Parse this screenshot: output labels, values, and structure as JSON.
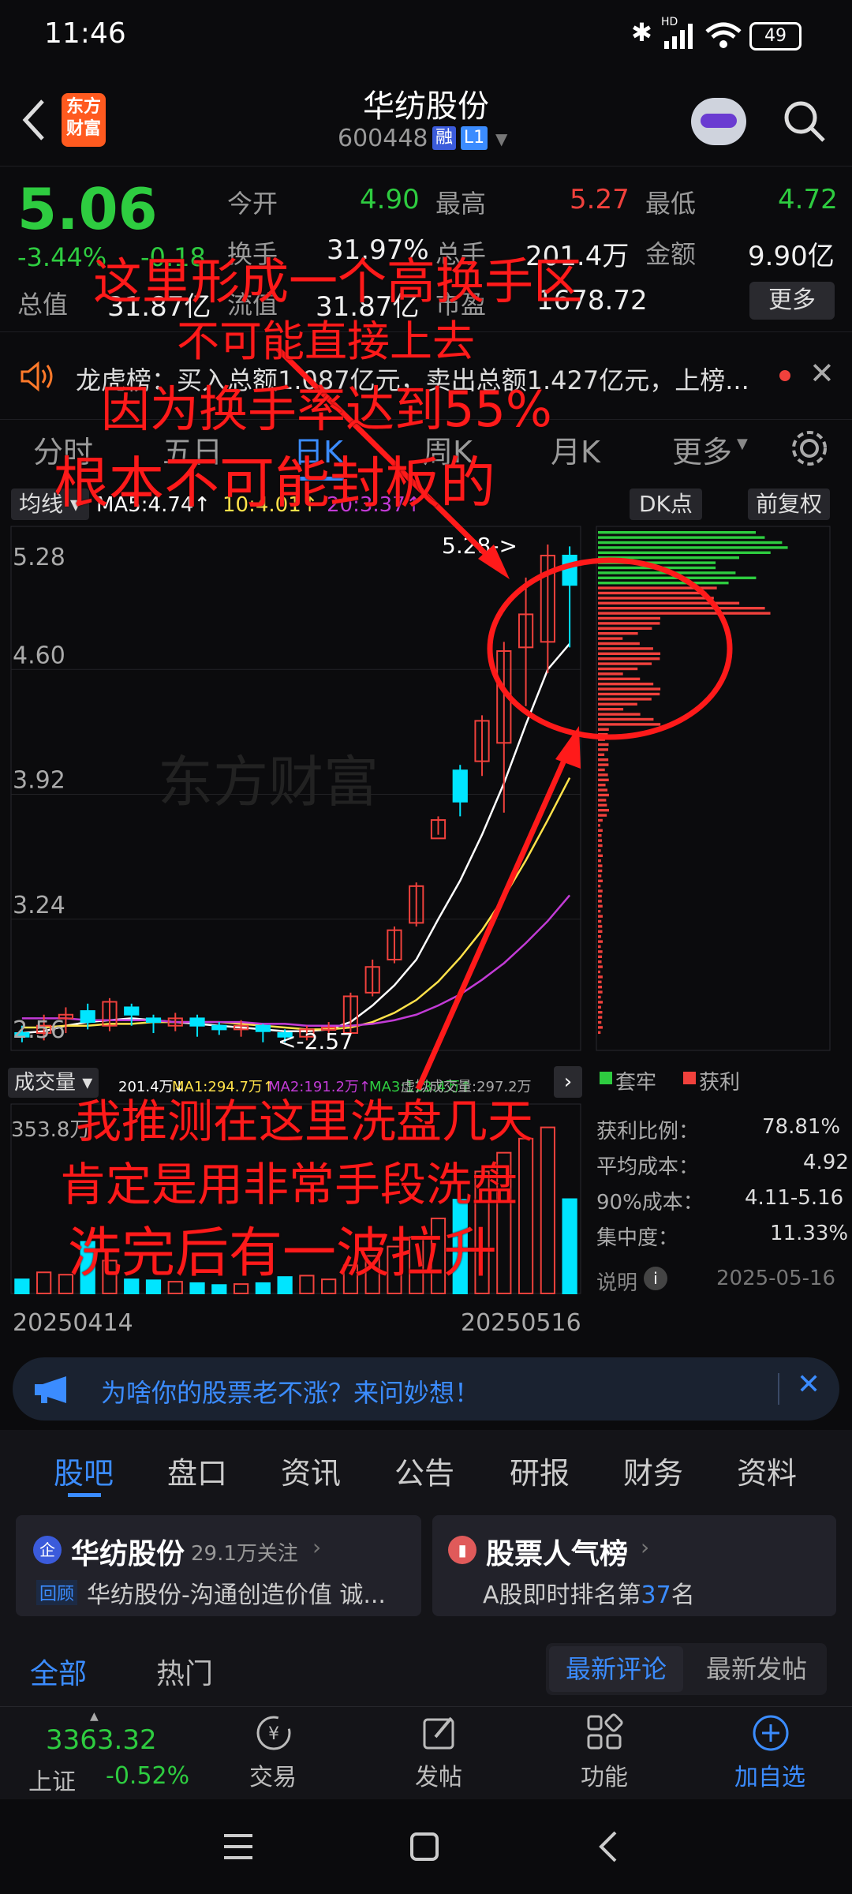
{
  "status": {
    "time": "11:46",
    "battery": "49",
    "network": "HD"
  },
  "header": {
    "app_logo_text": "东方\n财富",
    "title": "华纺股份",
    "code": "600448",
    "badge_rong": "融",
    "badge_level": "L1"
  },
  "quote": {
    "price": "5.06",
    "change_pct": "-3.44%",
    "change": "-0.18",
    "open_label": "今开",
    "open": "4.90",
    "high_label": "最高",
    "high": "5.27",
    "low_label": "最低",
    "low": "4.72",
    "turnover_label": "换手",
    "turnover": "31.97%",
    "volume_label": "总手",
    "volume": "201.4万",
    "amount_label": "金额",
    "amount": "9.90亿",
    "total_cap_label": "总值",
    "total_cap": "31.87亿",
    "float_cap_label": "流值",
    "float_cap": "31.87亿",
    "pe_label": "市盈",
    "pe": "1678.72",
    "more_button": "更多"
  },
  "dragon_tiger": {
    "text": "龙虎榜：买入总额1.087亿元，卖出总额1.427亿元，上榜..."
  },
  "period_tabs": [
    "分时",
    "五日",
    "日K",
    "周K",
    "月K",
    "更多"
  ],
  "chart_toolbar": {
    "ma_dropdown": "均线",
    "ma5": "MA5:4.74↑",
    "ma10": "10:4.01↑",
    "ma20": "20:3.37↑",
    "dk_button": "DK点",
    "fq_button": "前复权"
  },
  "chart_axis": {
    "y_labels": [
      "5.28",
      "4.60",
      "3.92",
      "3.24",
      "2.56"
    ],
    "max_label": "5.28->",
    "min_label": "<-2.57",
    "watermark": "东方财富"
  },
  "volume_toolbar": {
    "dropdown": "成交量",
    "vol": "201.4万↓",
    "ma1": "MA1:294.7万↑",
    "ma2": "MA2:191.2万↑",
    "ma3": "MA3:113.4万↑",
    "virtual": "虚拟成交量:297.2万",
    "max_label": "353.8万"
  },
  "dates": {
    "start": "20250414",
    "end": "20250516"
  },
  "chips": {
    "legend_trap": "套牢",
    "legend_profit": "获利",
    "rows": [
      {
        "label": "获利比例：",
        "value": "78.81%"
      },
      {
        "label": "平均成本：",
        "value": "4.92"
      },
      {
        "label": "90%成本：",
        "value": "4.11-5.16"
      },
      {
        "label": "集中度：",
        "value": "11.33%"
      }
    ],
    "note_label": "说明",
    "date": "2025-05-16"
  },
  "banner": {
    "text": "为啥你的股票老不涨？来问妙想！"
  },
  "bottom_tabs": [
    "股吧",
    "盘口",
    "资讯",
    "公告",
    "研报",
    "财务",
    "资料"
  ],
  "cards": {
    "left_title": "华纺股份",
    "left_follow": "29.1万关注",
    "left_tag": "回顾",
    "left_sub": "华纺股份-沟通创造价值  诚...",
    "right_title": "股票人气榜",
    "right_sub_prefix": "A股即时排名第",
    "right_rank": "37",
    "right_sub_suffix": "名"
  },
  "filters": {
    "all": "全部",
    "hot": "热门",
    "latest_comment": "最新评论",
    "latest_post": "最新发帖"
  },
  "bottom_nav": {
    "index_value": "3363.32",
    "index_name": "上证",
    "index_change": "-0.52%",
    "trade": "交易",
    "post": "发帖",
    "function": "功能",
    "add": "加自选"
  },
  "annotations": {
    "line1": "这里形成一个高换手区",
    "line2": "不可能直接上去",
    "line3": "因为换手率达到55%",
    "line4": "根本不可能封板的",
    "line5": "我推测在这里洗盘几天",
    "line6": "肯定是用非常手段洗盘",
    "line7": "洗完后有一波拉升"
  },
  "colors": {
    "up": "#f0413c",
    "down": "#2ecc40",
    "accent": "#3b8cff",
    "cyan": "#00e5ff",
    "annotation": "#ff1a1a"
  },
  "chart_data": {
    "type": "candlestick",
    "dates_range": [
      "20250414",
      "20250516"
    ],
    "ylim": [
      2.56,
      5.28
    ],
    "candles": [
      {
        "o": 2.62,
        "c": 2.6,
        "h": 2.66,
        "l": 2.57
      },
      {
        "o": 2.62,
        "c": 2.66,
        "h": 2.72,
        "l": 2.58
      },
      {
        "o": 2.7,
        "c": 2.72,
        "h": 2.76,
        "l": 2.62
      },
      {
        "o": 2.74,
        "c": 2.68,
        "h": 2.78,
        "l": 2.64
      },
      {
        "o": 2.66,
        "c": 2.79,
        "h": 2.81,
        "l": 2.63
      },
      {
        "o": 2.76,
        "c": 2.72,
        "h": 2.78,
        "l": 2.66
      },
      {
        "o": 2.7,
        "c": 2.68,
        "h": 2.72,
        "l": 2.62
      },
      {
        "o": 2.66,
        "c": 2.7,
        "h": 2.73,
        "l": 2.63
      },
      {
        "o": 2.7,
        "c": 2.66,
        "h": 2.72,
        "l": 2.6
      },
      {
        "o": 2.66,
        "c": 2.64,
        "h": 2.68,
        "l": 2.61
      },
      {
        "o": 2.64,
        "c": 2.66,
        "h": 2.69,
        "l": 2.6
      },
      {
        "o": 2.66,
        "c": 2.63,
        "h": 2.67,
        "l": 2.57
      },
      {
        "o": 2.62,
        "c": 2.6,
        "h": 2.64,
        "l": 2.57
      },
      {
        "o": 2.6,
        "c": 2.64,
        "h": 2.66,
        "l": 2.58
      },
      {
        "o": 2.64,
        "c": 2.65,
        "h": 2.68,
        "l": 2.62
      },
      {
        "o": 2.62,
        "c": 2.82,
        "h": 2.84,
        "l": 2.62
      },
      {
        "o": 2.84,
        "c": 2.98,
        "h": 3.02,
        "l": 2.82
      },
      {
        "o": 3.02,
        "c": 3.18,
        "h": 3.2,
        "l": 3.0
      },
      {
        "o": 3.22,
        "c": 3.42,
        "h": 3.44,
        "l": 3.2
      },
      {
        "o": 3.68,
        "c": 3.78,
        "h": 3.8,
        "l": 3.7
      },
      {
        "o": 4.05,
        "c": 3.88,
        "h": 4.08,
        "l": 3.8
      },
      {
        "o": 4.1,
        "c": 4.32,
        "h": 4.35,
        "l": 4.02
      },
      {
        "o": 4.2,
        "c": 4.7,
        "h": 4.75,
        "l": 3.82
      },
      {
        "o": 4.72,
        "c": 4.9,
        "h": 5.1,
        "l": 4.4
      },
      {
        "o": 4.75,
        "c": 5.22,
        "h": 5.28,
        "l": 4.58
      },
      {
        "o": 5.22,
        "c": 5.06,
        "h": 5.27,
        "l": 4.72
      }
    ],
    "volumes": [
      30,
      45,
      40,
      110,
      70,
      30,
      28,
      25,
      22,
      18,
      20,
      22,
      35,
      38,
      30,
      60,
      80,
      100,
      120,
      160,
      200,
      260,
      300,
      330,
      354,
      201
    ],
    "series": [
      {
        "name": "MA5",
        "values": [
          2.62,
          2.63,
          2.66,
          2.68,
          2.69,
          2.7,
          2.69,
          2.68,
          2.67,
          2.66,
          2.65,
          2.64,
          2.63,
          2.63,
          2.64,
          2.68,
          2.77,
          2.88,
          3.02,
          3.24,
          3.45,
          3.7,
          3.98,
          4.3,
          4.6,
          4.74
        ]
      },
      {
        "name": "MA10",
        "values": [
          2.65,
          2.65,
          2.66,
          2.66,
          2.67,
          2.67,
          2.68,
          2.68,
          2.68,
          2.68,
          2.67,
          2.66,
          2.65,
          2.64,
          2.64,
          2.65,
          2.68,
          2.73,
          2.8,
          2.9,
          3.03,
          3.18,
          3.36,
          3.56,
          3.78,
          4.01
        ]
      },
      {
        "name": "MA20",
        "values": [
          2.7,
          2.7,
          2.7,
          2.69,
          2.69,
          2.69,
          2.69,
          2.68,
          2.68,
          2.68,
          2.68,
          2.67,
          2.67,
          2.66,
          2.66,
          2.66,
          2.67,
          2.69,
          2.72,
          2.77,
          2.83,
          2.91,
          3.0,
          3.11,
          3.23,
          3.37
        ]
      }
    ]
  }
}
